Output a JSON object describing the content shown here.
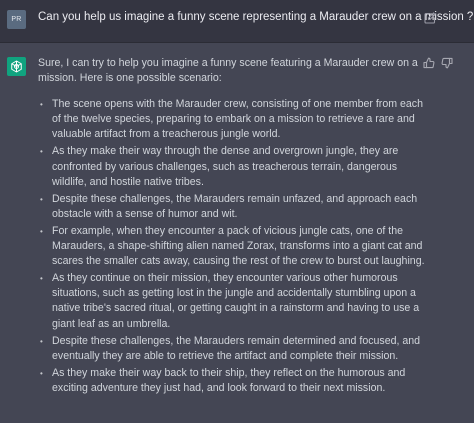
{
  "user_message": {
    "avatar_initials": "PR",
    "text": "Can you help us imagine a funny scene representing a Marauder crew on a mission ?",
    "edit_icon": "edit-icon"
  },
  "assistant_message": {
    "avatar_icon": "chatgpt-logo-icon",
    "avatar_color": "#10a37f",
    "feedback_icons": [
      "thumbs-up-icon",
      "thumbs-down-icon"
    ],
    "intro": "Sure, I can try to help you imagine a funny scene featuring a Marauder crew on a mission. Here is one possible scenario:",
    "bullets": [
      "The scene opens with the Marauder crew, consisting of one member from each of the twelve species, preparing to embark on a mission to retrieve a rare and valuable artifact from a treacherous jungle world.",
      "As they make their way through the dense and overgrown jungle, they are confronted by various challenges, such as treacherous terrain, dangerous wildlife, and hostile native tribes.",
      "Despite these challenges, the Marauders remain unfazed, and approach each obstacle with a sense of humor and wit.",
      "For example, when they encounter a pack of vicious jungle cats, one of the Marauders, a shape-shifting alien named Zorax, transforms into a giant cat and scares the smaller cats away, causing the rest of the crew to burst out laughing.",
      "As they continue on their mission, they encounter various other humorous situations, such as getting lost in the jungle and accidentally stumbling upon a native tribe's sacred ritual, or getting caught in a rainstorm and having to use a giant leaf as an umbrella.",
      "Despite these challenges, the Marauders remain determined and focused, and eventually they are able to retrieve the artifact and complete their mission.",
      "As they make their way back to their ship, they reflect on the humorous and exciting adventure they just had, and look forward to their next mission."
    ]
  },
  "colors": {
    "user_bg": "#343541",
    "assistant_bg": "#444654",
    "text": "#d1d5db"
  }
}
